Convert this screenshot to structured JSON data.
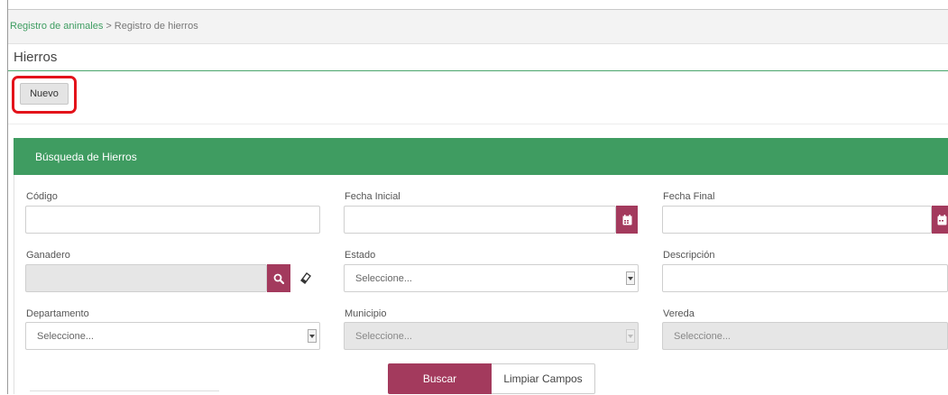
{
  "breadcrumb": {
    "parent": "Registro de animales",
    "separator": ">",
    "current": "Registro de hierros"
  },
  "page": {
    "title": "Hierros",
    "new_button": "Nuevo"
  },
  "panel": {
    "title": "Búsqueda de Hierros"
  },
  "form": {
    "codigo": {
      "label": "Código",
      "value": ""
    },
    "fecha_inicial": {
      "label": "Fecha Inicial",
      "value": ""
    },
    "fecha_final": {
      "label": "Fecha Final",
      "value": ""
    },
    "ganadero": {
      "label": "Ganadero",
      "value": ""
    },
    "estado": {
      "label": "Estado",
      "selected": "Seleccione..."
    },
    "descripcion": {
      "label": "Descripción",
      "value": ""
    },
    "departamento": {
      "label": "Departamento",
      "selected": "Seleccione..."
    },
    "municipio": {
      "label": "Municipio",
      "selected": "Seleccione..."
    },
    "vereda": {
      "label": "Vereda",
      "selected": "Seleccione..."
    }
  },
  "actions": {
    "search": "Buscar",
    "clear": "Limpiar Campos"
  },
  "colors": {
    "brand_green": "#3f9c61",
    "accent_maroon": "#a33a5d",
    "highlight_red": "#e3131b"
  },
  "icons": {
    "calendar": "calendar-icon",
    "search": "search-icon",
    "eraser": "eraser-icon",
    "dropdown": "chevron-down-icon"
  }
}
